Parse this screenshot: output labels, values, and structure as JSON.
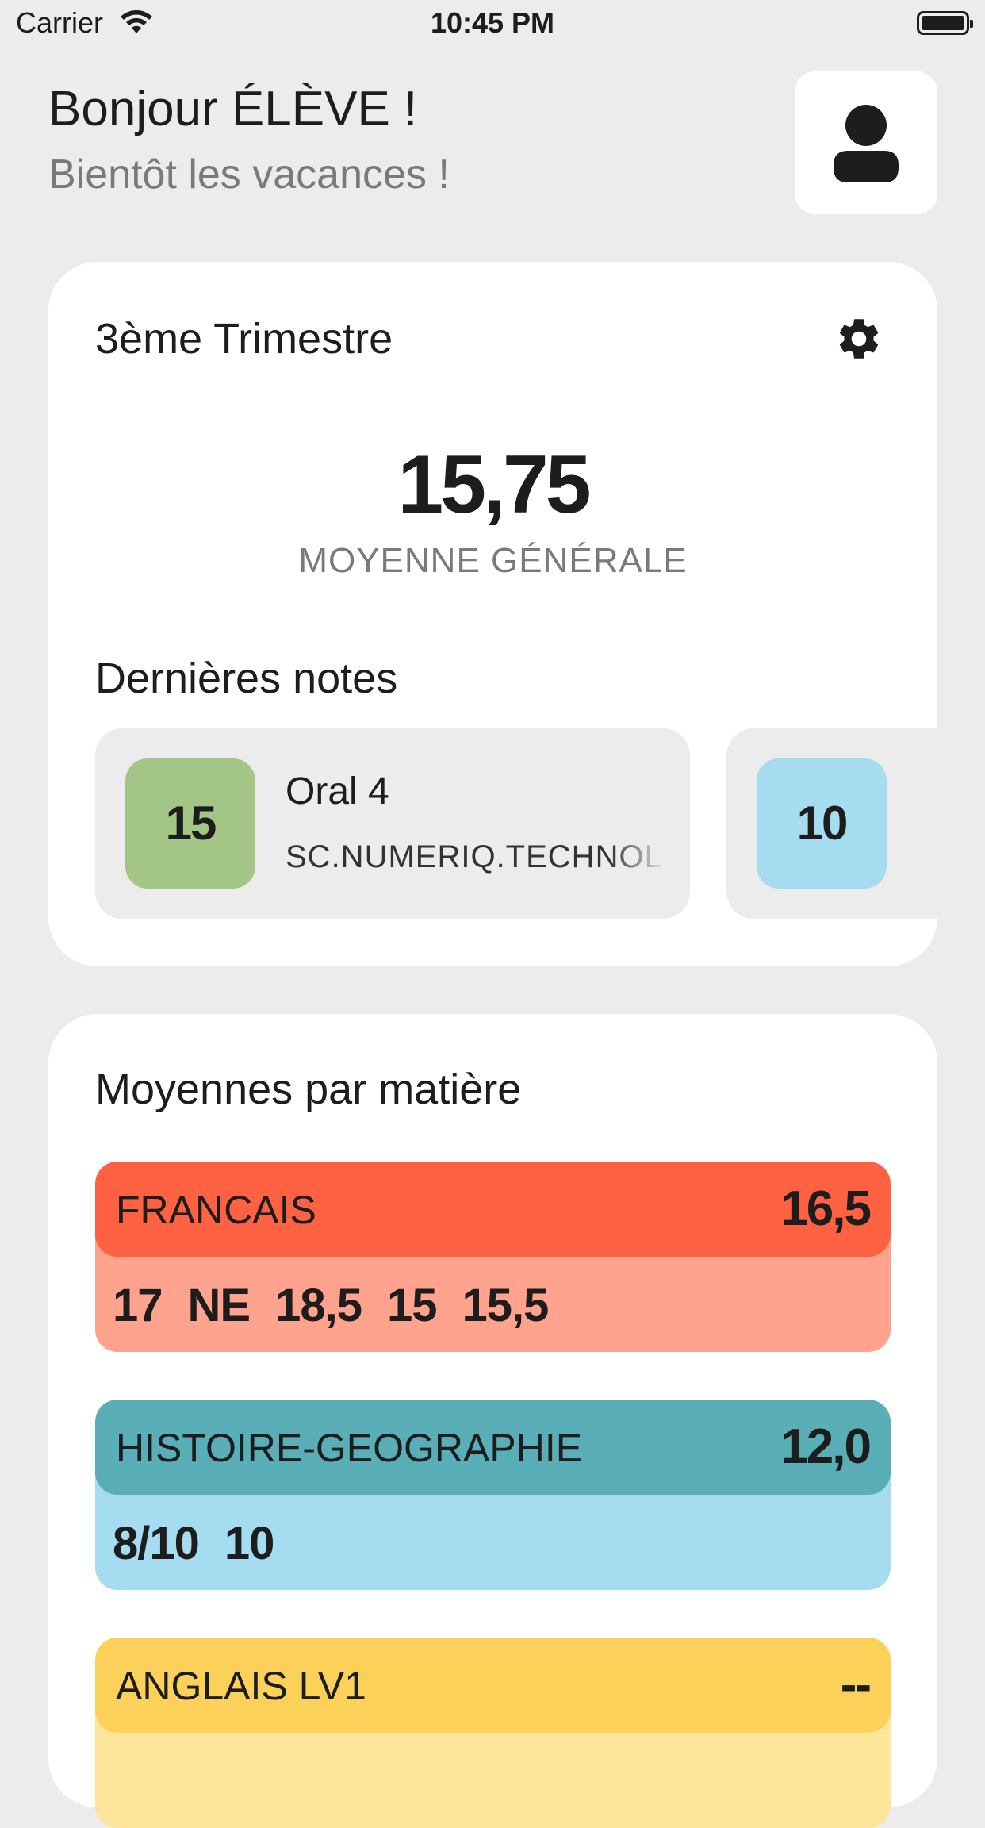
{
  "status_bar": {
    "carrier": "Carrier",
    "time": "10:45 PM"
  },
  "header": {
    "greeting": "Bonjour ÉLÈVE !",
    "subtitle": "Bientôt les vacances !",
    "avatar_icon": "user-icon"
  },
  "term": {
    "title": "3ème Trimestre",
    "settings_icon": "gear-icon",
    "average": "15,75",
    "average_label": "MOYENNE GÉNÉRALE",
    "recent_title": "Dernières notes",
    "recent_notes": [
      {
        "grade": "15",
        "title": "Oral 4",
        "subject": "SC.NUMERIQ.TECHNOL",
        "color": "#a3c686"
      },
      {
        "grade": "10",
        "title": "",
        "subject": "",
        "color": "#a6dcf0"
      }
    ]
  },
  "subjects": {
    "title": "Moyennes par matière",
    "items": [
      {
        "name": "FRANCAIS",
        "average": "16,5",
        "grades": [
          "17",
          "NE",
          "18,5",
          "15",
          "15,5"
        ],
        "head_color": "#ff6242",
        "body_color": "#ffa28e"
      },
      {
        "name": "HISTOIRE-GEOGRAPHIE",
        "average": "12,0",
        "grades": [
          "8/10",
          "10"
        ],
        "head_color": "#5aaeb8",
        "body_color": "#a6dcf0"
      },
      {
        "name": "ANGLAIS LV1",
        "average": "--",
        "grades": [],
        "head_color": "#fcd15a",
        "body_color": "#fde59a"
      }
    ]
  }
}
